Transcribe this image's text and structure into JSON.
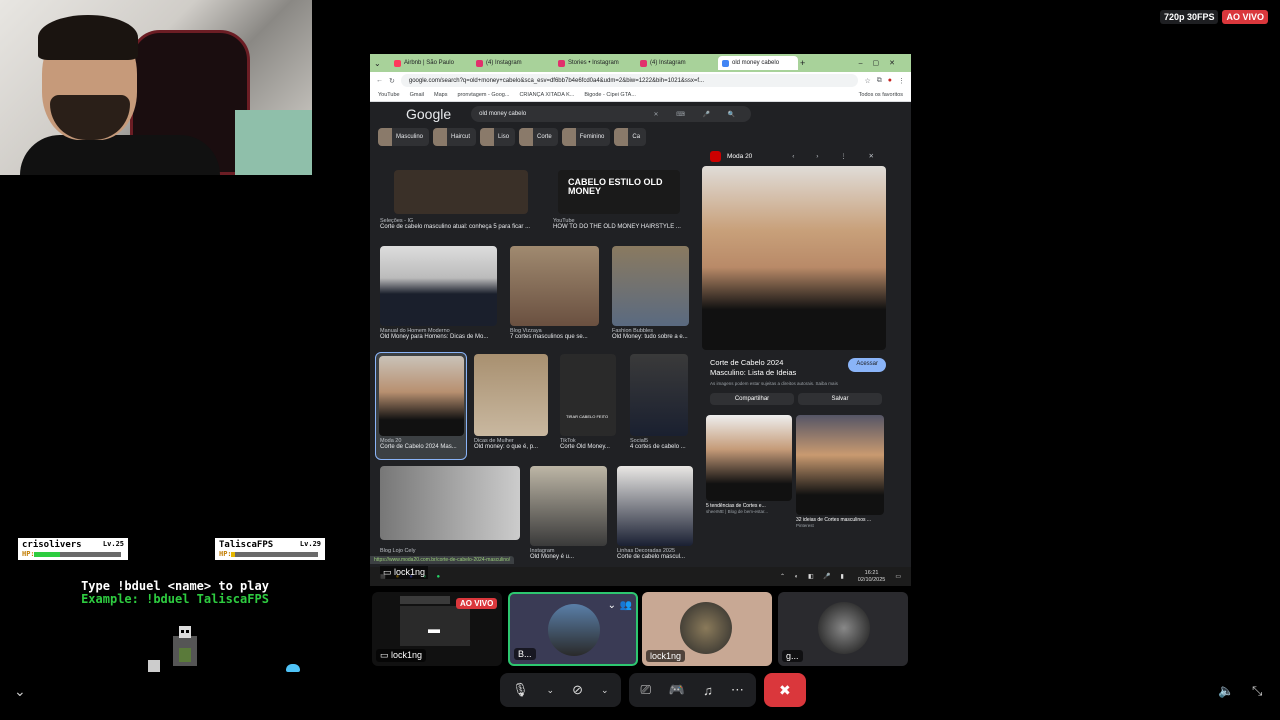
{
  "stream": {
    "quality": "720p 30FPS",
    "live": "AO VIVO"
  },
  "game": {
    "players": [
      {
        "name": "crisolivers",
        "level": "Lv.25",
        "hp_label": "HP:",
        "hp": 0.3
      },
      {
        "name": "TaliscaFPS",
        "level": "Lv.29",
        "hp_label": "HP:",
        "hp": 0.05
      }
    ],
    "instruction": "Type !bduel <name> to play",
    "example": "Example: !bduel TaliscaFPS"
  },
  "browser": {
    "tabs": [
      {
        "label": "Airbnb | São Paulo",
        "color": "#ff385c"
      },
      {
        "label": "(4) Instagram",
        "color": "#e1306c"
      },
      {
        "label": "Stories • Instagram",
        "color": "#e1306c"
      },
      {
        "label": "(4) Instagram",
        "color": "#e1306c"
      },
      {
        "label": "old money cabelo",
        "color": "#4285f4"
      }
    ],
    "url": "google.com/search?q=old+money+cabelo&sca_esv=df6bb7b4e6fcd0a4&udm=2&biw=1222&bih=1021&ssx=f...",
    "bookmarks": [
      "YouTube",
      "Gmail",
      "Maps",
      "pronvtagem - Goog...",
      "CRIANÇA XITADA K...",
      "Bigode - Cipei GTA...",
      "Todos os favoritos"
    ],
    "search": {
      "logo": "Google",
      "query": "old money cabelo"
    },
    "chips": [
      "Masculino",
      "Haircut",
      "Liso",
      "Corte",
      "Feminino",
      "Ca"
    ],
    "results": [
      {
        "source": "Seleções - IG",
        "title": "Corte de cabelo masculino atual: conheça 5 para ficar ..."
      },
      {
        "source": "YouTube",
        "title": "HOW TO DO THE OLD MONEY HAIRSTYLE ..."
      },
      {
        "source": "Manual do Homem Moderno",
        "title": "Old Money para Homens: Dicas de Mo..."
      },
      {
        "source": "Blog Vizzaya",
        "title": "7 cortes masculinos que se..."
      },
      {
        "source": "Fashion Bubbles",
        "title": "Old Money: tudo sobre a e..."
      },
      {
        "source": "Moda 20",
        "title": "Corte de Cabelo 2024 Mas..."
      },
      {
        "source": "Dicas de Mulher",
        "title": "Old money: o que é, p..."
      },
      {
        "source": "TikTok",
        "title": "Corte Old Money..."
      },
      {
        "source": "Social5",
        "title": "4 cortes de cabelo ..."
      },
      {
        "source": "Blog Lojo Cely",
        "title": ""
      },
      {
        "source": "Instagram",
        "title": "Old Money é u..."
      },
      {
        "source": "Linhas Decoradas 2025",
        "title": "Corte de cabelo mascul..."
      }
    ],
    "thumb_text": "CABELO ESTILO OLD MONEY",
    "tiktok_text": "TIRAR CABELO FEITO",
    "panel": {
      "source": "Moda 20",
      "title": "Corte de Cabelo 2024 Masculino: Lista de Ideias",
      "visit": "Acessar",
      "notice": "As imagens podem estar sujeitas a direitos autorais. Saiba mais",
      "share": "Compartilhar",
      "save": "Salvar",
      "related": [
        {
          "title": "5 tendências de Cortes e...",
          "source": "sheerME | Blog de bem-estar..."
        },
        {
          "title": "32 ideias de Cortes masculinos ...",
          "source": "Pinterest"
        }
      ]
    },
    "status_url": "https://www.moda20.com.br/corte-de-cabelo-2024-masculino/"
  },
  "taskbar": {
    "user": "lock1ng",
    "time": "16:21",
    "date": "02/10/2025"
  },
  "tiles": [
    {
      "label": "lock1ng",
      "live": "AO VIVO"
    },
    {
      "label": "B..."
    },
    {
      "label": "lock1ng"
    },
    {
      "label": "g..."
    }
  ]
}
